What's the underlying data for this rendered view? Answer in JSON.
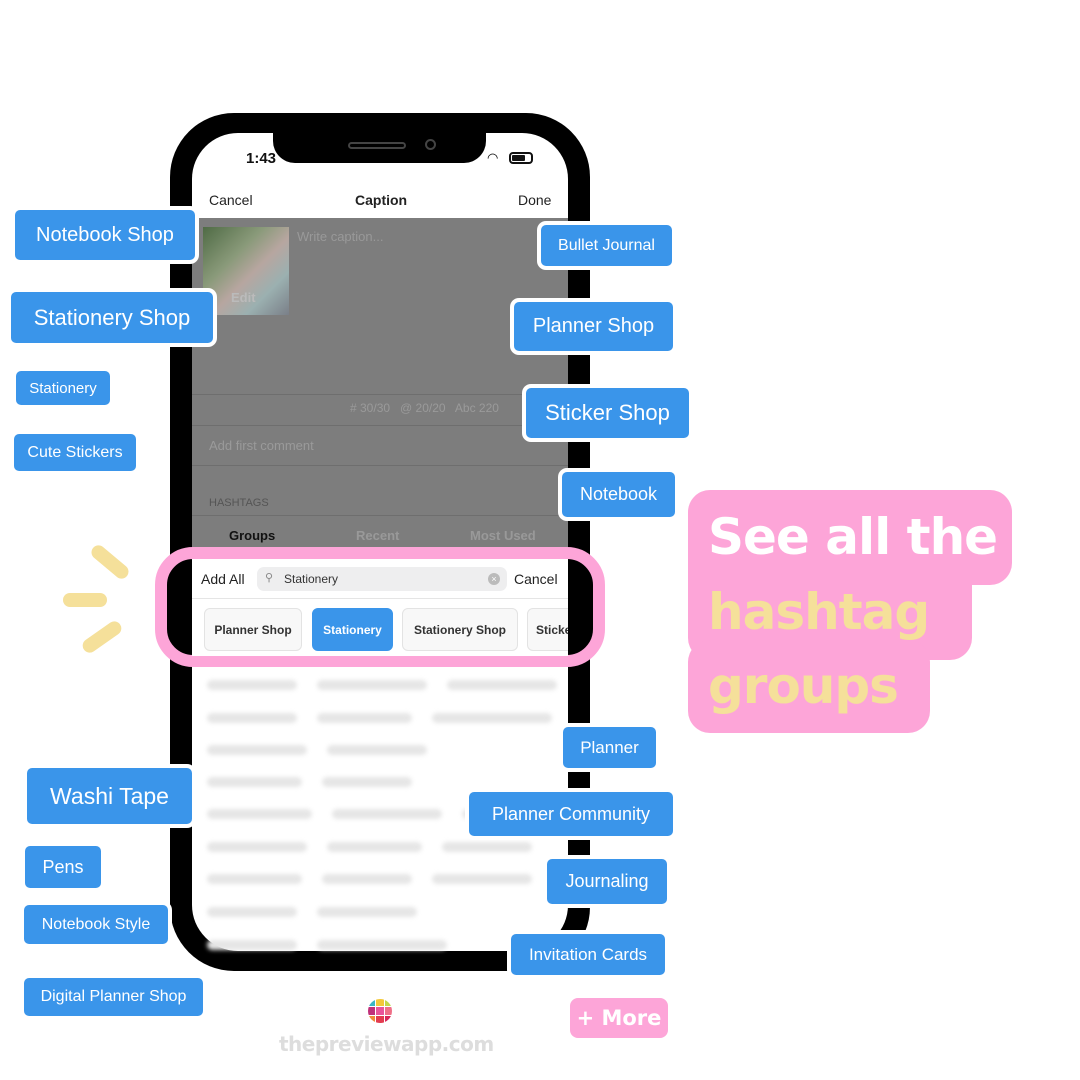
{
  "status": {
    "time": "1:43"
  },
  "nav": {
    "cancel": "Cancel",
    "title": "Caption",
    "done": "Done"
  },
  "caption": {
    "placeholder": "Write caption...",
    "edit": "Edit",
    "counts": "# 30/30   @ 20/20   Abc 220",
    "comment": "Add first comment"
  },
  "hashtags": {
    "label": "HASHTAGS",
    "tabs": [
      "Groups",
      "Recent",
      "Most Used"
    ]
  },
  "searchbar": {
    "add_all": "Add All",
    "value": "Stationery",
    "cancel": "Cancel"
  },
  "chips": [
    "Planner Shop",
    "Stationery",
    "Stationery Shop",
    "Sticke"
  ],
  "tags_left": [
    "Notebook Shop",
    "Stationery Shop",
    "Stationery",
    "Cute Stickers",
    "Washi Tape",
    "Pens",
    "Notebook Style",
    "Digital Planner Shop"
  ],
  "tags_right": [
    "Bullet Journal",
    "Planner Shop",
    "Sticker Shop",
    "Notebook",
    "Planner",
    "Planner Community",
    "Journaling",
    "Invitation Cards"
  ],
  "more": "+ More",
  "promo": {
    "line1": "See all the",
    "line2": "hashtag",
    "line3": "groups"
  },
  "brand": "thepreviewapp.com",
  "colors": {
    "tag": "#3a95ea",
    "pink": "#fda5d8",
    "yellow": "#f5e09a"
  }
}
